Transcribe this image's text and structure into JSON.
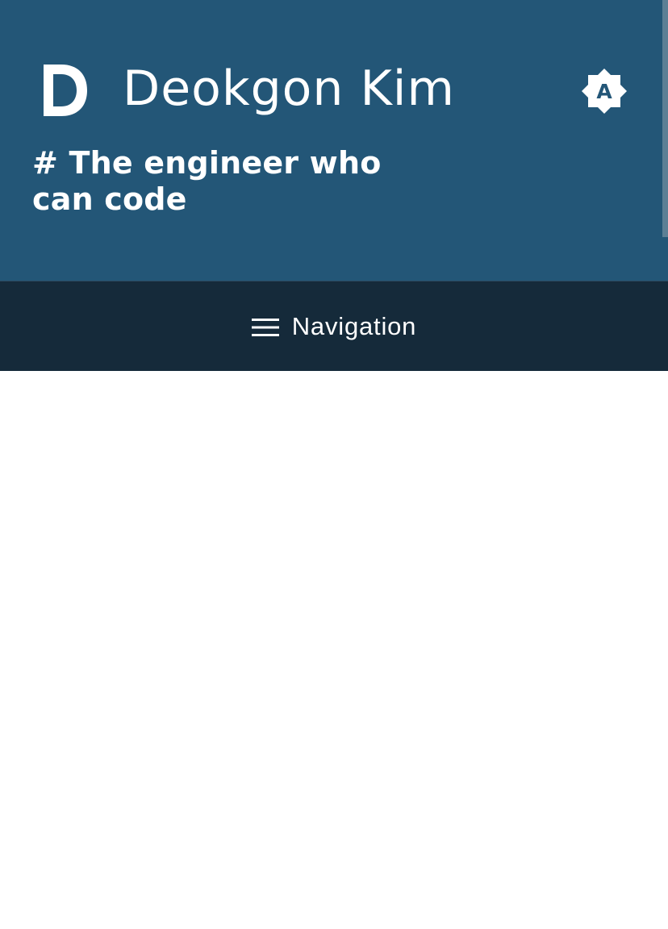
{
  "header": {
    "logo_letter": "D",
    "title": "Deokgon Kim",
    "tagline": "# The engineer who can code",
    "theme_toggle_letter": "A",
    "background_color": "#235677"
  },
  "nav": {
    "label": "Navigation",
    "icon": "menu-icon",
    "background_color": "#152a3a"
  },
  "colors": {
    "header_bg": "#235677",
    "nav_bg": "#152a3a",
    "text": "#ffffff"
  }
}
